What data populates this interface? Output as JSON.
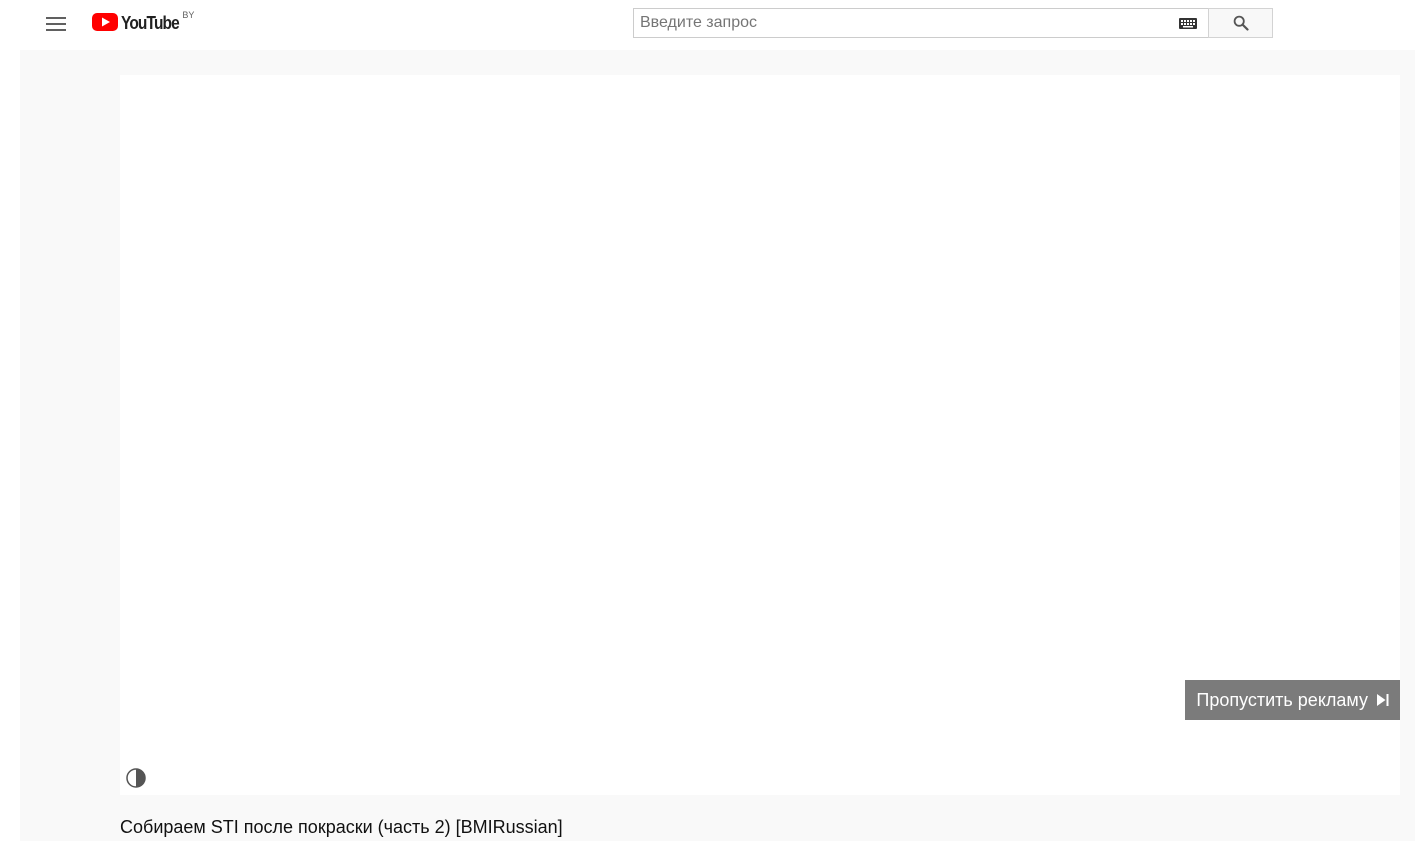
{
  "header": {
    "logo_text": "YouTube",
    "country_code": "BY",
    "search": {
      "placeholder": "Введите запрос",
      "value": ""
    },
    "icons": {
      "menu": "hamburger-menu-icon",
      "logo": "youtube-play-logo-icon",
      "keyboard": "keyboard-icon",
      "search": "search-icon"
    }
  },
  "player": {
    "skip_ad_label": "Пропустить рекламу",
    "icons": {
      "skip": "skip-next-icon",
      "contrast": "contrast-icon"
    }
  },
  "video": {
    "title": "Собираем STI после покраски (часть 2) [BMIRussian]"
  },
  "colors": {
    "brand_red": "#ff0000",
    "page_background": "#f9f9f9",
    "skip_ad_background": "#646464"
  }
}
